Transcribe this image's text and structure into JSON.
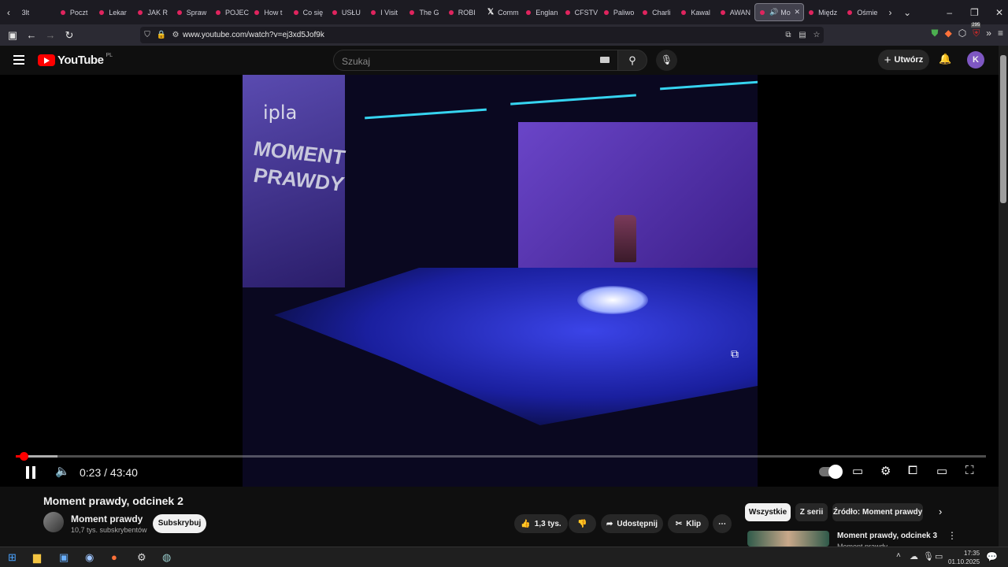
{
  "browser": {
    "tabs": [
      "3lt",
      "Poczt",
      "Lekar",
      "JAK R",
      "Spraw",
      "POJEC",
      "How t",
      "Co się",
      "USŁU",
      "I Visit",
      "The G",
      "ROBI",
      "Comm",
      "Englan",
      "CFSTV",
      "Paliwo",
      "Charli",
      "Kawal",
      "AWAN",
      "Mo",
      "Międz",
      "Ośmie"
    ],
    "active_tab": "Mo",
    "url": "www.youtube.com/watch?v=ej3xd5Jof9k",
    "badge_count": "295"
  },
  "youtube": {
    "logo": "YouTube",
    "country": "PL",
    "search_placeholder": "Szukaj",
    "create_label": "Utwórz",
    "avatar_letter": "K"
  },
  "player": {
    "current_time": "0:23",
    "duration": "43:40",
    "time_display": "0:23 / 43:40",
    "progress_fraction": 0.0088,
    "buffered_fraction": 0.043,
    "video_text": {
      "logo": "ipla",
      "line1": "MOMENT",
      "line2": "PRAWDY"
    }
  },
  "video": {
    "title": "Moment prawdy, odcinek 2",
    "channel": "Moment prawdy",
    "subscribers": "10,7 tys. subskrybentów",
    "subscribe_label": "Subskrybuj",
    "likes": "1,3 tys.",
    "share_label": "Udostępnij",
    "clip_label": "Klip"
  },
  "sidebar": {
    "chips": [
      "Wszystkie",
      "Z serii",
      "Źródło: Moment prawdy"
    ],
    "related_title": "Moment prawdy, odcinek 3",
    "related_channel": "Moment prawdy"
  },
  "taskbar": {
    "time": "17:35",
    "date": "01.10.2025"
  }
}
